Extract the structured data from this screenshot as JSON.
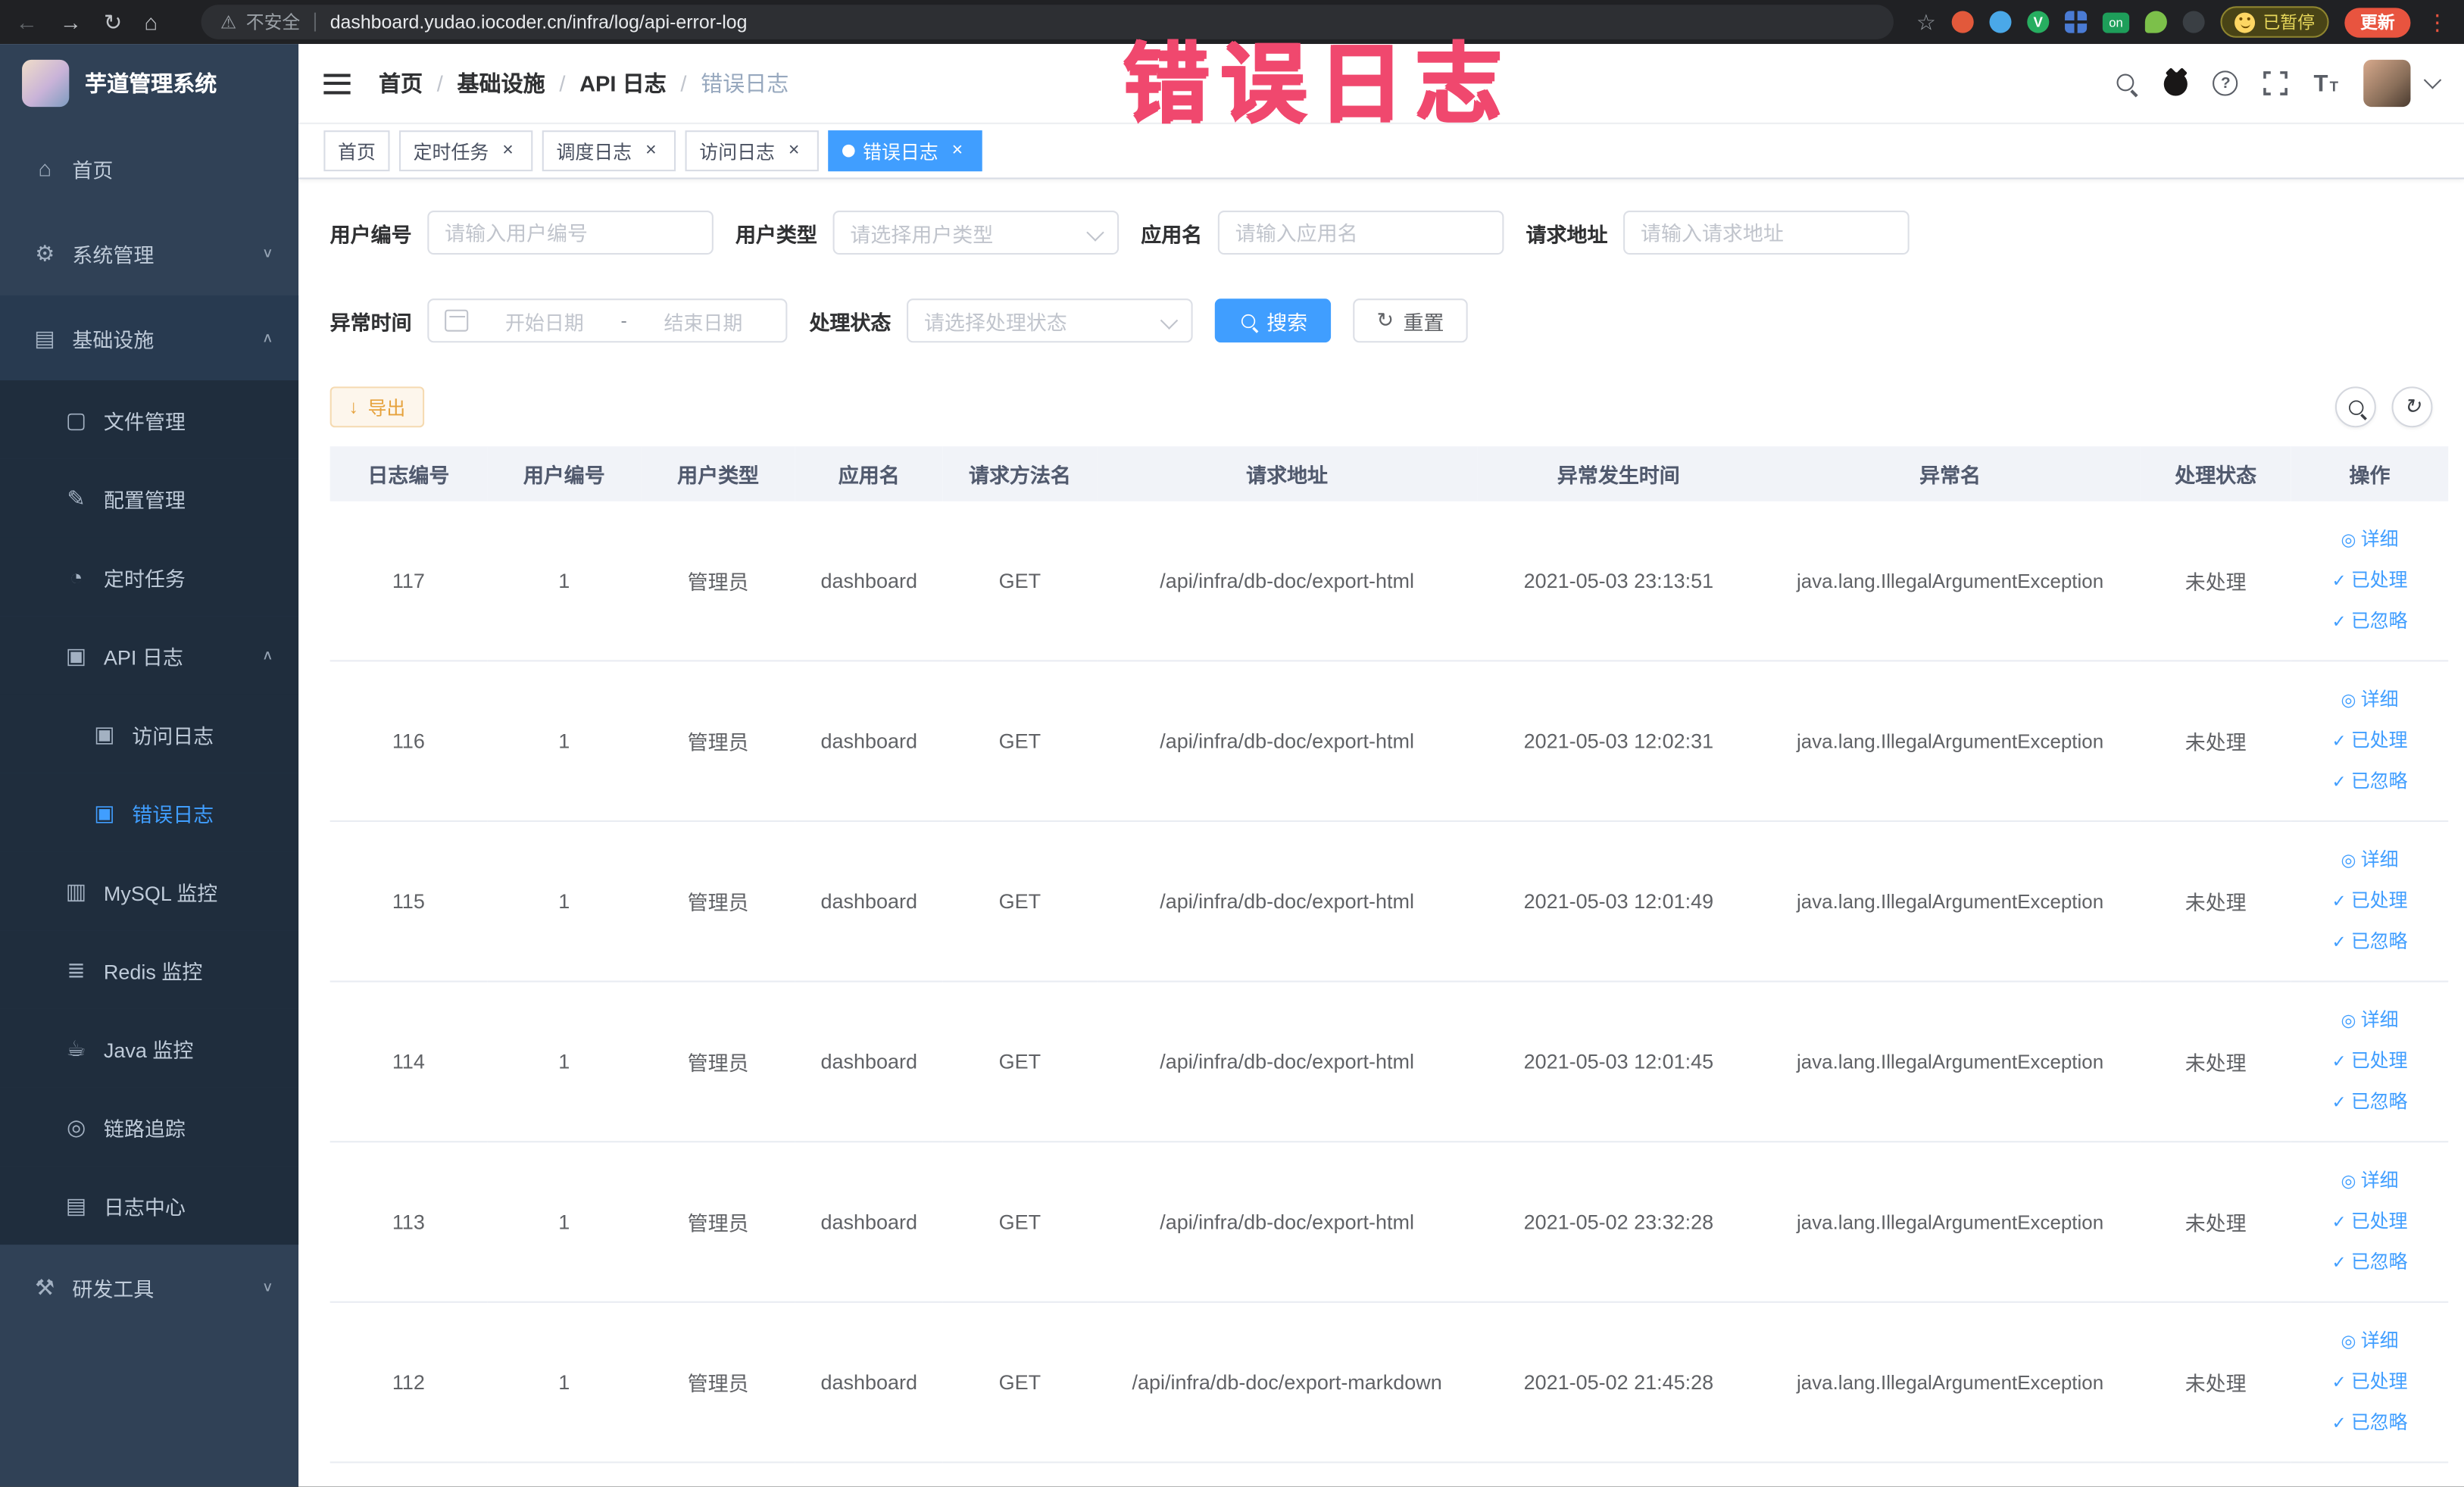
{
  "watermark": "错误日志",
  "colors": {
    "accent": "#409EFF",
    "warning": "#E6A23C",
    "sidebar_bg": "#304156",
    "watermark": "#F0486E"
  },
  "browser": {
    "security_label": "不安全",
    "url": "dashboard.yudao.iocoder.cn/infra/log/api-error-log",
    "paused_badge": "已暂停",
    "update_button": "更新"
  },
  "sidebar": {
    "logo_title": "芋道管理系统",
    "items": [
      {
        "label": "首页",
        "icon": "home-icon",
        "level": 1
      },
      {
        "label": "系统管理",
        "icon": "gear-icon",
        "level": 1,
        "chevron": "chevron-down-icon"
      },
      {
        "label": "基础设施",
        "icon": "infra-icon",
        "level": 1,
        "chevron": "chevron-up-icon",
        "open": true
      },
      {
        "label": "文件管理",
        "icon": "file-icon",
        "level": 2,
        "sub": true
      },
      {
        "label": "配置管理",
        "icon": "config-icon",
        "level": 2,
        "sub": true
      },
      {
        "label": "定时任务",
        "icon": "timer-icon",
        "level": 2,
        "sub": true
      },
      {
        "label": "API 日志",
        "icon": "api-log-icon",
        "level": 2,
        "sub": true,
        "chevron": "chevron-up-icon",
        "open": true
      },
      {
        "label": "访问日志",
        "icon": "access-log-icon",
        "level": 3,
        "sub": true
      },
      {
        "label": "错误日志",
        "icon": "error-log-icon",
        "level": 3,
        "sub": true,
        "active": true
      },
      {
        "label": "MySQL 监控",
        "icon": "mysql-icon",
        "level": 2,
        "sub": true
      },
      {
        "label": "Redis 监控",
        "icon": "redis-icon",
        "level": 2,
        "sub": true
      },
      {
        "label": "Java 监控",
        "icon": "java-icon",
        "level": 2,
        "sub": true
      },
      {
        "label": "链路追踪",
        "icon": "trace-icon",
        "level": 2,
        "sub": true
      },
      {
        "label": "日志中心",
        "icon": "log-center-icon",
        "level": 2,
        "sub": true
      },
      {
        "label": "研发工具",
        "icon": "tools-icon",
        "level": 1,
        "chevron": "chevron-down-icon"
      }
    ]
  },
  "navbar": {
    "breadcrumb": [
      "首页",
      "基础设施",
      "API 日志",
      "错误日志"
    ]
  },
  "tags": [
    {
      "label": "首页",
      "closable": false,
      "active": false
    },
    {
      "label": "定时任务",
      "closable": true,
      "active": false
    },
    {
      "label": "调度日志",
      "closable": true,
      "active": false
    },
    {
      "label": "访问日志",
      "closable": true,
      "active": false
    },
    {
      "label": "错误日志",
      "closable": true,
      "active": true
    }
  ],
  "filters": {
    "user_id": {
      "label": "用户编号",
      "placeholder": "请输入用户编号"
    },
    "user_type": {
      "label": "用户类型",
      "placeholder": "请选择用户类型"
    },
    "app_name": {
      "label": "应用名",
      "placeholder": "请输入应用名"
    },
    "request_url": {
      "label": "请求地址",
      "placeholder": "请输入请求地址"
    },
    "exception_time": {
      "label": "异常时间",
      "start_placeholder": "开始日期",
      "separator": "-",
      "end_placeholder": "结束日期"
    },
    "process_status": {
      "label": "处理状态",
      "placeholder": "请选择处理状态"
    },
    "search_button": "搜索",
    "reset_button": "重置"
  },
  "toolbar": {
    "export_button": "导出"
  },
  "table": {
    "columns": [
      "日志编号",
      "用户编号",
      "用户类型",
      "应用名",
      "请求方法名",
      "请求地址",
      "异常发生时间",
      "异常名",
      "处理状态",
      "操作"
    ],
    "actions": {
      "detail": "详细",
      "processed": "已处理",
      "ignored": "已忽略"
    },
    "rows": [
      {
        "id": "117",
        "user_id": "1",
        "user_type": "管理员",
        "app": "dashboard",
        "method": "GET",
        "url": "/api/infra/db-doc/export-html",
        "time": "2021-05-03 23:13:51",
        "exception": "java.lang.IllegalArgumentException",
        "status": "未处理"
      },
      {
        "id": "116",
        "user_id": "1",
        "user_type": "管理员",
        "app": "dashboard",
        "method": "GET",
        "url": "/api/infra/db-doc/export-html",
        "time": "2021-05-03 12:02:31",
        "exception": "java.lang.IllegalArgumentException",
        "status": "未处理"
      },
      {
        "id": "115",
        "user_id": "1",
        "user_type": "管理员",
        "app": "dashboard",
        "method": "GET",
        "url": "/api/infra/db-doc/export-html",
        "time": "2021-05-03 12:01:49",
        "exception": "java.lang.IllegalArgumentException",
        "status": "未处理"
      },
      {
        "id": "114",
        "user_id": "1",
        "user_type": "管理员",
        "app": "dashboard",
        "method": "GET",
        "url": "/api/infra/db-doc/export-html",
        "time": "2021-05-03 12:01:45",
        "exception": "java.lang.IllegalArgumentException",
        "status": "未处理"
      },
      {
        "id": "113",
        "user_id": "1",
        "user_type": "管理员",
        "app": "dashboard",
        "method": "GET",
        "url": "/api/infra/db-doc/export-html",
        "time": "2021-05-02 23:32:28",
        "exception": "java.lang.IllegalArgumentException",
        "status": "未处理"
      },
      {
        "id": "112",
        "user_id": "1",
        "user_type": "管理员",
        "app": "dashboard",
        "method": "GET",
        "url": "/api/infra/db-doc/export-markdown",
        "time": "2021-05-02 21:45:28",
        "exception": "java.lang.IllegalArgumentException",
        "status": "未处理"
      }
    ]
  }
}
